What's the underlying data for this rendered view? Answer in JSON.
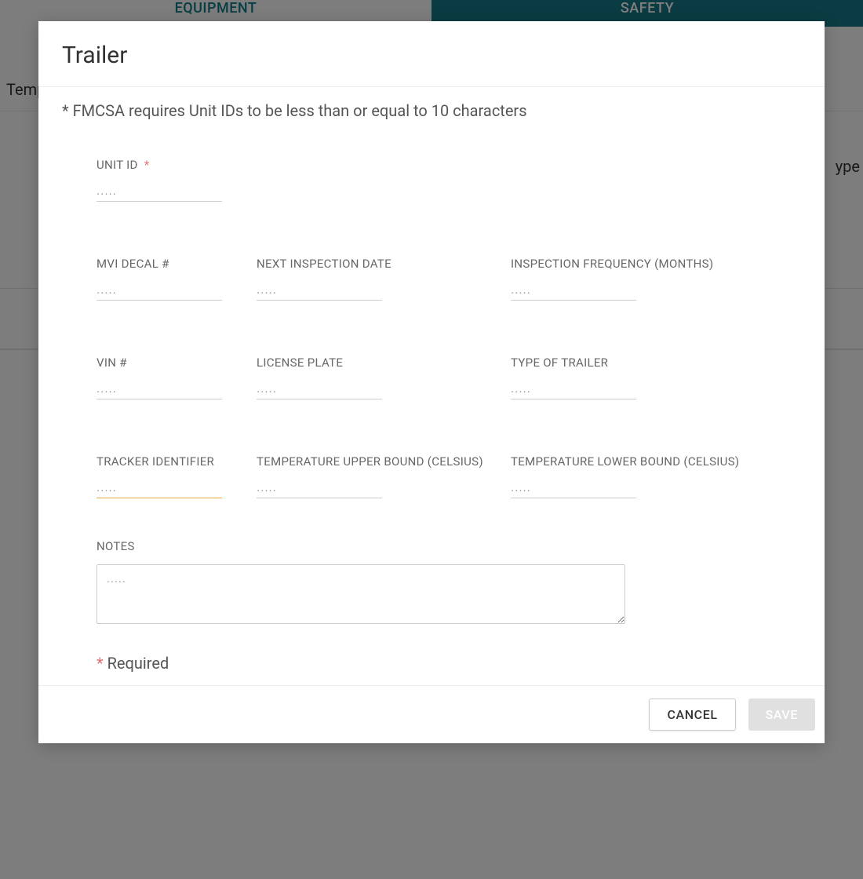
{
  "background": {
    "tab_equipment": "EQUIPMENT",
    "tab_safety": "SAFETY",
    "temp_fragment": "Temp",
    "ype_fragment": "ype"
  },
  "modal": {
    "title": "Trailer",
    "helper": "* FMCSA requires Unit IDs to be less than or equal to 10 characters",
    "placeholder": ".....",
    "required_mark": "*",
    "required_text": "Required",
    "fields": {
      "unit_id": {
        "label": "UNIT ID",
        "value": "",
        "required": true
      },
      "mvi_decal": {
        "label": "MVI DECAL #",
        "value": ""
      },
      "next_inspection": {
        "label": "NEXT INSPECTION DATE",
        "value": ""
      },
      "inspection_freq": {
        "label": "INSPECTION FREQUENCY (MONTHS)",
        "value": ""
      },
      "vin": {
        "label": "VIN #",
        "value": ""
      },
      "license_plate": {
        "label": "LICENSE PLATE",
        "value": ""
      },
      "trailer_type": {
        "label": "TYPE OF TRAILER",
        "value": ""
      },
      "tracker_id": {
        "label": "TRACKER IDENTIFIER",
        "value": ""
      },
      "temp_upper": {
        "label": "TEMPERATURE UPPER BOUND (CELSIUS)",
        "value": ""
      },
      "temp_lower": {
        "label": "TEMPERATURE LOWER BOUND (CELSIUS)",
        "value": ""
      },
      "notes": {
        "label": "NOTES",
        "value": ""
      }
    },
    "buttons": {
      "cancel": "CANCEL",
      "save": "SAVE"
    }
  }
}
